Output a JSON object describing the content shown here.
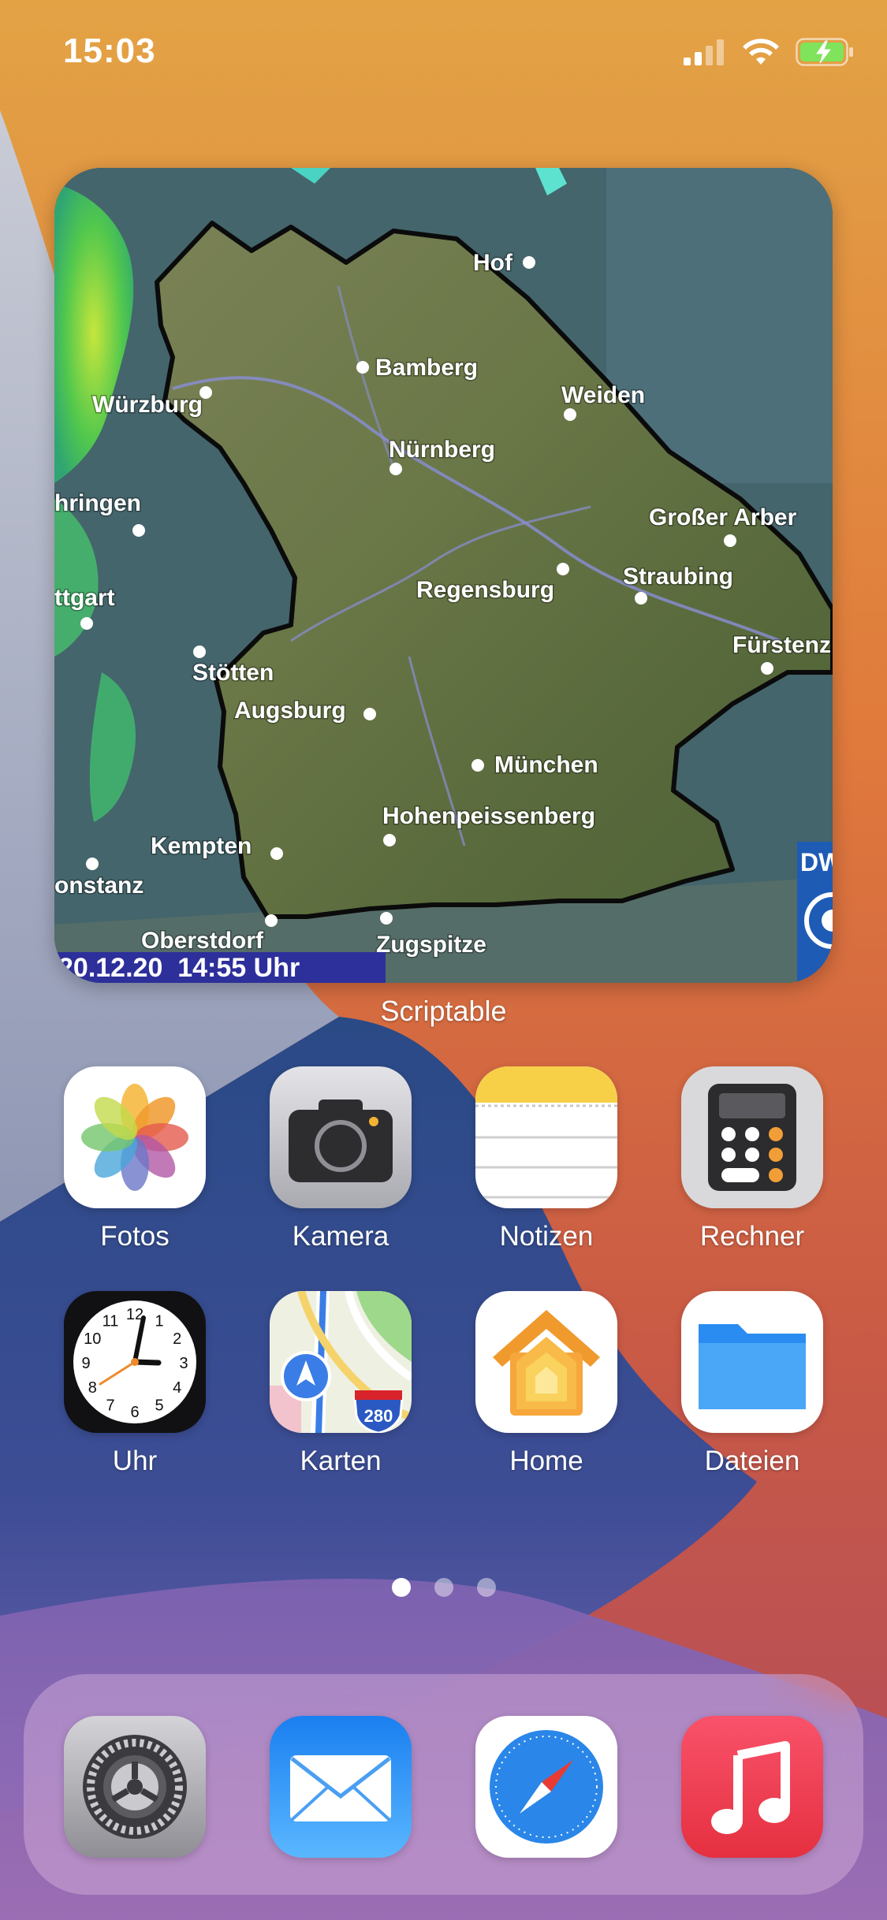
{
  "status_bar": {
    "time": "15:03",
    "icons": [
      "cellular-signal-icon",
      "wifi-icon",
      "battery-charging-icon"
    ],
    "battery_color": "#7fe35b"
  },
  "widget": {
    "app_name": "Scriptable",
    "map": {
      "cities": [
        "Hof",
        "Bamberg",
        "Würzburg",
        "Weiden",
        "Nürnberg",
        "hringen",
        "Großer Arber",
        "Regensburg",
        "Straubing",
        "ttgart",
        "Fürstenz",
        "Stötten",
        "Augsburg",
        "München",
        "Hohenpeissenberg",
        "Kempten",
        "onstanz",
        "Oberstdorf",
        "Zugspitze"
      ],
      "timestamp": "20.12.20  14:55 Uhr",
      "badge": "DW"
    }
  },
  "apps": [
    {
      "label": "Fotos",
      "icon": "photos-icon"
    },
    {
      "label": "Kamera",
      "icon": "camera-icon"
    },
    {
      "label": "Notizen",
      "icon": "notes-icon"
    },
    {
      "label": "Rechner",
      "icon": "calculator-icon"
    },
    {
      "label": "Uhr",
      "icon": "clock-icon"
    },
    {
      "label": "Karten",
      "icon": "maps-icon",
      "badge": "280"
    },
    {
      "label": "Home",
      "icon": "home-icon"
    },
    {
      "label": "Dateien",
      "icon": "files-icon"
    }
  ],
  "clock": {
    "numerals": [
      "12",
      "1",
      "2",
      "3",
      "4",
      "5",
      "6",
      "7",
      "8",
      "9",
      "10",
      "11"
    ]
  },
  "page_dots": {
    "count": 3,
    "active": 0
  },
  "dock": [
    {
      "icon": "settings-icon"
    },
    {
      "icon": "mail-icon"
    },
    {
      "icon": "safari-icon"
    },
    {
      "icon": "music-icon"
    }
  ]
}
